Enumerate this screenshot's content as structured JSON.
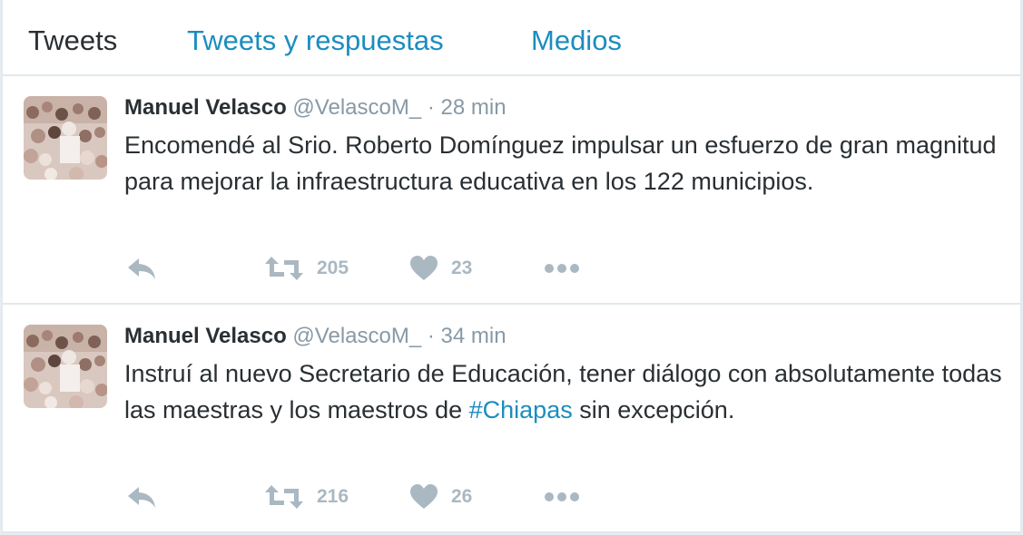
{
  "tabs": [
    {
      "label": "Tweets",
      "active": true
    },
    {
      "label": "Tweets y respuestas",
      "active": false
    },
    {
      "label": "Medios",
      "active": false
    }
  ],
  "colors": {
    "link": "#1b8dbf",
    "text": "#292f33",
    "muted": "#8899a6",
    "icon": "#aab8c2"
  },
  "tweets": [
    {
      "name": "Manuel Velasco",
      "handle": "@VelascoM_",
      "time": "· 28 min",
      "text": "Encomendé al Srio. Roberto Domínguez impulsar un esfuerzo de gran magnitud para mejorar la infraestructura educativa en los 122 municipios.",
      "hashtag": "",
      "text_after": "",
      "retweets": "205",
      "likes": "23"
    },
    {
      "name": "Manuel Velasco",
      "handle": "@VelascoM_",
      "time": "· 34 min",
      "text": "Instruí al nuevo Secretario de Educación, tener diálogo con absolutamente todas las maestras y los maestros de ",
      "hashtag": "#Chiapas",
      "text_after": " sin excepción.",
      "retweets": "216",
      "likes": "26"
    }
  ],
  "icons": {
    "reply": "reply-icon",
    "retweet": "retweet-icon",
    "like": "heart-icon",
    "more": "more-icon"
  }
}
